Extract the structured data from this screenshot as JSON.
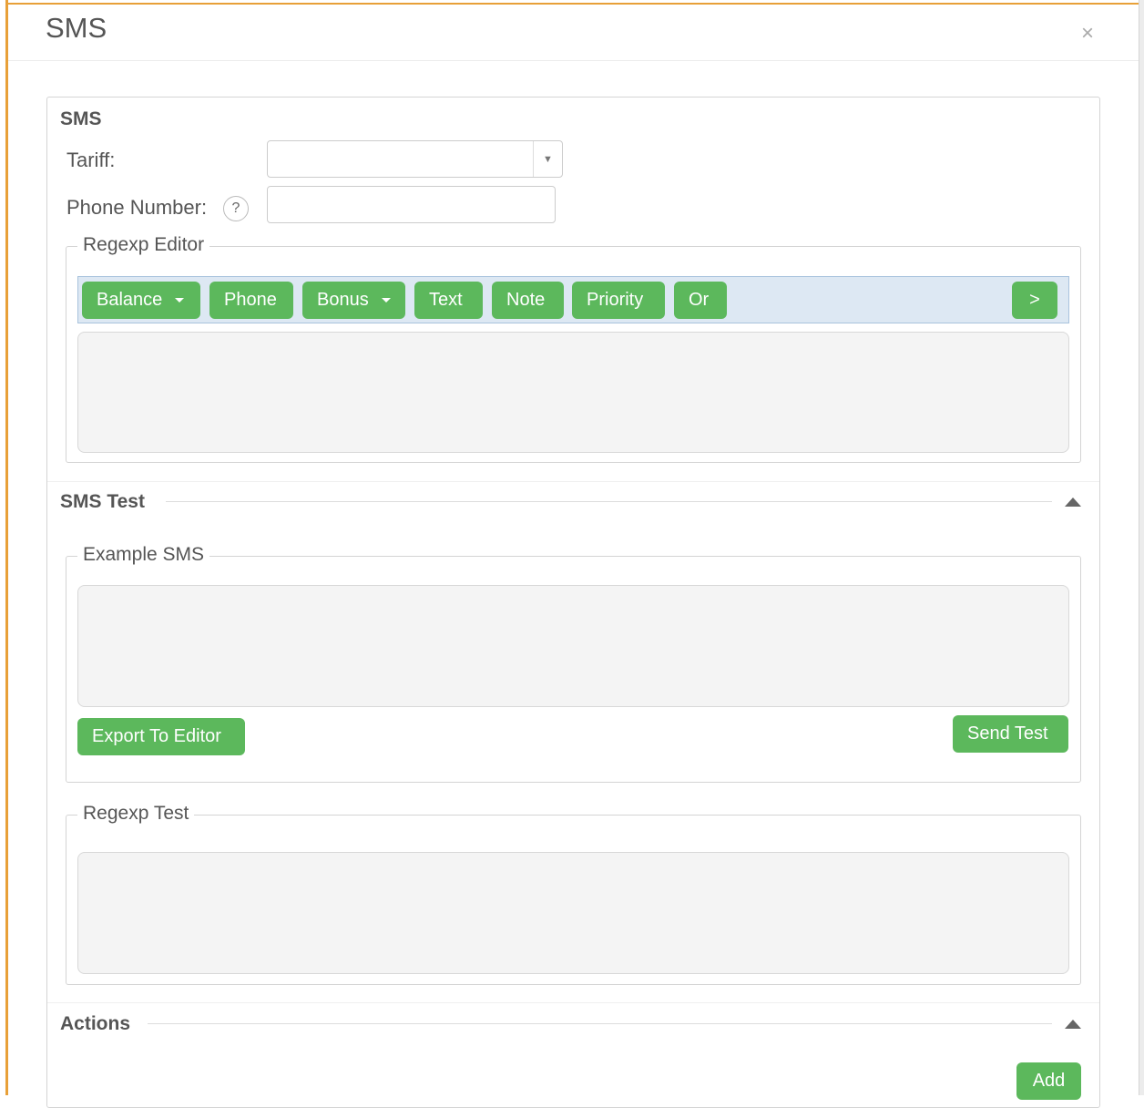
{
  "modal": {
    "title": "SMS",
    "close_glyph": "×"
  },
  "sms_section": {
    "title": "SMS",
    "tariff": {
      "label": "Tariff:",
      "value": "",
      "arrow_glyph": "▼"
    },
    "phone": {
      "label": "Phone Number:",
      "help_glyph": "?",
      "value": ""
    }
  },
  "regexp_editor": {
    "legend": "Regexp Editor",
    "buttons": [
      {
        "label": "Balance",
        "dropdown": true
      },
      {
        "label": "Phone",
        "dropdown": false
      },
      {
        "label": "Bonus",
        "dropdown": true
      },
      {
        "label": "Text",
        "dropdown": false
      },
      {
        "label": "Note",
        "dropdown": false
      },
      {
        "label": "Priority",
        "dropdown": false
      },
      {
        "label": "Or",
        "dropdown": false
      }
    ],
    "next_label": ">",
    "content": ""
  },
  "sms_test": {
    "title": "SMS Test",
    "example": {
      "legend": "Example SMS",
      "content": "",
      "export_label": "Export To Editor",
      "send_label": "Send Test"
    },
    "regexp_test": {
      "legend": "Regexp Test",
      "content": ""
    }
  },
  "actions": {
    "title": "Actions",
    "add_label": "Add"
  },
  "colors": {
    "accent_green": "#5cb85c",
    "frame_orange": "#e8a038",
    "toolbar_blue": "#dde8f3"
  },
  "icons": {
    "close": "close-icon",
    "dropdown": "chevron-down-icon",
    "help": "help-icon",
    "collapse": "collapse-up-icon"
  }
}
